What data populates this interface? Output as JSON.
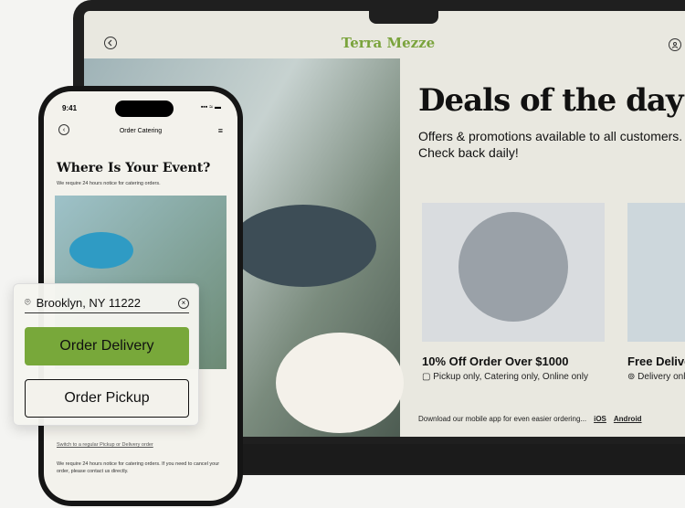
{
  "laptop": {
    "brand": "Terra Mezze",
    "deals_title": "Deals of the day",
    "deals_sub": "Offers & promotions available to all customers. Check back daily!",
    "cards": [
      {
        "title": "10% Off Order Over $1000",
        "meta": "Pickup only, Catering only, Online only"
      },
      {
        "title": "Free Delive",
        "meta": "Delivery only"
      }
    ],
    "app_line": "Download our mobile app for even easier ordering...",
    "ios": "iOS",
    "android": "Android"
  },
  "phone": {
    "time": "9:41",
    "status": "▪▪▪ ≈ ▬",
    "header_title": "Order Catering",
    "event_title": "Where Is Your Event?",
    "event_sub": "We require 24 hours notice for catering orders.",
    "switch_link": "Switch to a regular Pickup or Delivery order",
    "note": "We require 24 hours notice for catering orders. If you need to cancel your order, please contact us directly."
  },
  "order_card": {
    "location": "Brooklyn, NY 11222",
    "delivery_label": "Order Delivery",
    "pickup_label": "Order Pickup"
  }
}
